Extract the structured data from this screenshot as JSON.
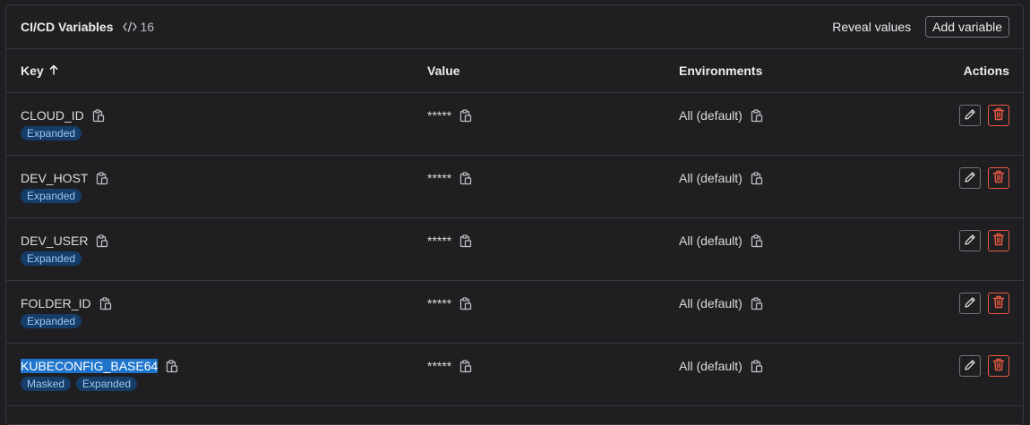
{
  "header": {
    "title": "CI/CD Variables",
    "count": "16",
    "reveal_label": "Reveal values",
    "add_label": "Add variable"
  },
  "columns": {
    "key": "Key",
    "value": "Value",
    "environments": "Environments",
    "actions": "Actions"
  },
  "rows": [
    {
      "key": "CLOUD_ID",
      "value": "*****",
      "env": "All (default)",
      "badges": [
        "Expanded"
      ]
    },
    {
      "key": "DEV_HOST",
      "value": "*****",
      "env": "All (default)",
      "badges": [
        "Expanded"
      ]
    },
    {
      "key": "DEV_USER",
      "value": "*****",
      "env": "All (default)",
      "badges": [
        "Expanded"
      ]
    },
    {
      "key": "FOLDER_ID",
      "value": "*****",
      "env": "All (default)",
      "badges": [
        "Expanded"
      ]
    },
    {
      "key": "KUBECONFIG_BASE64",
      "value": "*****",
      "env": "All (default)",
      "badges": [
        "Masked",
        "Expanded"
      ],
      "selected": true
    }
  ],
  "icons": {
    "count": "code-icon",
    "sort": "arrow-up-icon",
    "copy": "copy-icon",
    "edit": "pencil-icon",
    "delete": "trash-icon"
  },
  "colors": {
    "background": "#1f1f22",
    "border": "#3a383f",
    "badge_bg": "#153d67",
    "badge_text": "#9dc7f1",
    "danger": "#ec5941",
    "selection": "#1f75cb"
  }
}
